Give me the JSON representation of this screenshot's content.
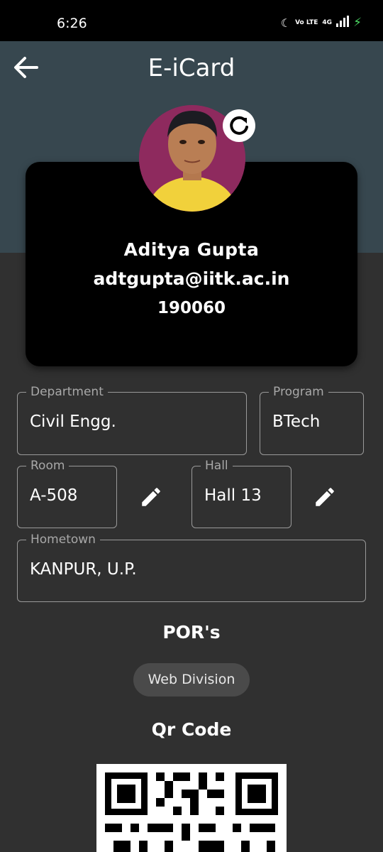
{
  "status_bar": {
    "time": "6:26",
    "network": "4G",
    "volte": "Vo LTE"
  },
  "header": {
    "title": "E-iCard"
  },
  "profile": {
    "name": "Aditya  Gupta",
    "email": "adtgupta@iitk.ac.in",
    "roll": "190060"
  },
  "fields": {
    "department": {
      "label": "Department",
      "value": "Civil Engg."
    },
    "program": {
      "label": "Program",
      "value": "BTech"
    },
    "room": {
      "label": "Room",
      "value": "A-508"
    },
    "hall": {
      "label": "Hall",
      "value": "Hall 13"
    },
    "hometown": {
      "label": "Hometown",
      "value": "KANPUR, U.P."
    }
  },
  "pors": {
    "title": "POR's",
    "items": [
      "Web Division"
    ]
  },
  "qr": {
    "title": "Qr Code"
  },
  "icons": [
    "moon-icon",
    "signal-icon",
    "battery-charging-icon",
    "back-arrow-icon",
    "refresh-icon",
    "edit-icon"
  ],
  "colors": {
    "header_bg": "#37474f",
    "page_bg": "#303030",
    "card_bg": "#000000"
  }
}
